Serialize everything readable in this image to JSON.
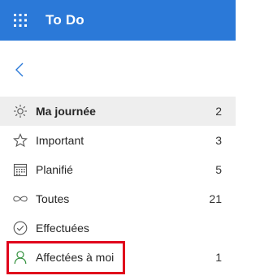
{
  "app": {
    "title": "To Do",
    "accent_color": "#2b79d8"
  },
  "icons": {
    "waffle": "app-launcher-icon",
    "back": "chevron-left-icon"
  },
  "nav": {
    "items": [
      {
        "label": "Ma journée",
        "count": "2",
        "icon": "sun-icon",
        "selected": true
      },
      {
        "label": "Important",
        "count": "3",
        "icon": "star-icon",
        "selected": false
      },
      {
        "label": "Planifié",
        "count": "5",
        "icon": "calendar-icon",
        "selected": false
      },
      {
        "label": "Toutes",
        "count": "21",
        "icon": "infinity-icon",
        "selected": false
      },
      {
        "label": "Effectuées",
        "count": "",
        "icon": "check-circle-icon",
        "selected": false
      },
      {
        "label": "Affectées à moi",
        "count": "1",
        "icon": "person-icon",
        "selected": false
      }
    ]
  },
  "annotation": {
    "highlight_color": "#e0001b"
  }
}
